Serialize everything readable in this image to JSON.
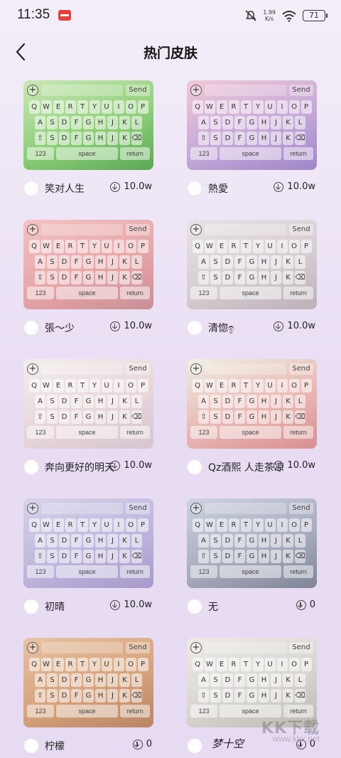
{
  "status_bar": {
    "time": "11:35",
    "net_speed_value": "1.99",
    "net_speed_unit": "K/s",
    "battery": "71"
  },
  "header": {
    "title": "热门皮肤"
  },
  "keyboard": {
    "plus": "+",
    "send": "Send",
    "row1": [
      "Q",
      "W",
      "E",
      "R",
      "T",
      "Y",
      "U",
      "I",
      "O",
      "P"
    ],
    "row2": [
      "A",
      "S",
      "D",
      "F",
      "G",
      "H",
      "J",
      "K",
      "L"
    ],
    "row3": [
      "⇧",
      "S",
      "D",
      "F",
      "G",
      "H",
      "J",
      "K",
      "⌫"
    ],
    "num": "123",
    "space": "space",
    "return": "return"
  },
  "skins": [
    {
      "author": "笑对人生",
      "downloads": "10.0w",
      "theme": "green",
      "colors": [
        "#c9e8b4",
        "#8fcf7a",
        "#5aa852"
      ]
    },
    {
      "author": "熱愛",
      "downloads": "10.0w",
      "theme": "city",
      "colors": [
        "#f1c9d6",
        "#c5a9d9",
        "#9f86c8"
      ]
    },
    {
      "author": "張～少",
      "downloads": "10.0w",
      "theme": "pink",
      "colors": [
        "#f4c3c3",
        "#e6a6a8",
        "#c98f97"
      ]
    },
    {
      "author": "清惚ඉ",
      "downloads": "10.0w",
      "theme": "photo",
      "colors": [
        "#e8e2e4",
        "#d6cdd3",
        "#bcb1b8"
      ]
    },
    {
      "author": "奔向更好的明天",
      "downloads": "10.0w",
      "theme": "anime",
      "colors": [
        "#f3eeee",
        "#e7d6da",
        "#d5c6ce"
      ]
    },
    {
      "author": "Qz酒熙   人走茶凉",
      "downloads": "10.0w",
      "theme": "red",
      "colors": [
        "#eef0e3",
        "#e8b8b4",
        "#d98f90"
      ]
    },
    {
      "author": "初晴",
      "downloads": "10.0w",
      "theme": "purple",
      "colors": [
        "#d7d2ea",
        "#bfb6dc",
        "#a79acb"
      ]
    },
    {
      "author": "无",
      "downloads": "0",
      "theme": "dark",
      "colors": [
        "#cdd3e0",
        "#a9adbf",
        "#7f8598"
      ]
    },
    {
      "author": "柠檬",
      "downloads": "0",
      "theme": "warm",
      "colors": [
        "#e7c3a3",
        "#d6a37d",
        "#b98563"
      ]
    },
    {
      "author": "",
      "downloads": "0",
      "theme": "bear",
      "colors": [
        "#ecebe8",
        "#d9d6d2",
        "#bdb8b3"
      ]
    }
  ],
  "signature": "梦十空",
  "watermark": {
    "title": "KK下载",
    "url": "www.kkx.net"
  }
}
